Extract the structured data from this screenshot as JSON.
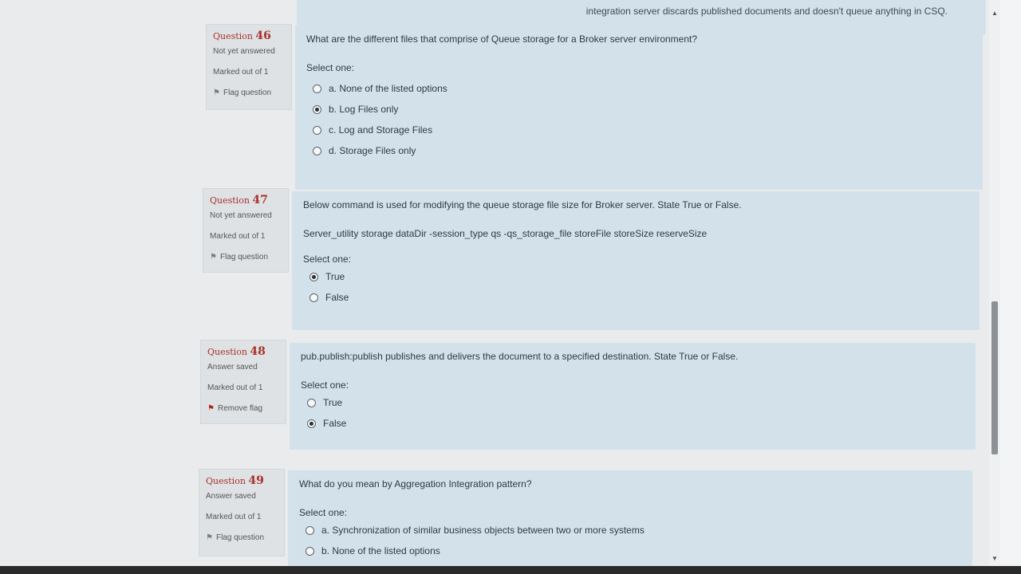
{
  "top_strip": {
    "text": "integration server discards published documents and doesn't queue anything in CSQ."
  },
  "questions": [
    {
      "label": "Question",
      "number": "46",
      "state": "Not yet answered",
      "mark": "Marked out of 1",
      "flag_label": "Flag question",
      "flagged": false,
      "text": "What are the different files that comprise of Queue storage for a Broker server environment?",
      "select_label": "Select one:",
      "options": [
        {
          "label": "a. None of the listed options",
          "checked": false
        },
        {
          "label": "b. Log Files only",
          "checked": true
        },
        {
          "label": "c. Log and Storage Files",
          "checked": false
        },
        {
          "label": "d. Storage Files only",
          "checked": false
        }
      ]
    },
    {
      "label": "Question",
      "number": "47",
      "state": "Not yet answered",
      "mark": "Marked out of 1",
      "flag_label": "Flag question",
      "flagged": false,
      "text": "Below command is used for modifying the queue storage file size for Broker server. State True or False.",
      "command": "Server_utility storage dataDir -session_type qs -qs_storage_file storeFile storeSize reserveSize",
      "select_label": "Select one:",
      "options": [
        {
          "label": "True",
          "checked": true
        },
        {
          "label": "False",
          "checked": false
        }
      ]
    },
    {
      "label": "Question",
      "number": "48",
      "state": "Answer saved",
      "mark": "Marked out of 1",
      "flag_label": "Remove flag",
      "flagged": true,
      "text": "pub.publish:publish publishes and delivers the document to a specified destination. State True or False.",
      "select_label": "Select one:",
      "options": [
        {
          "label": "True",
          "checked": false
        },
        {
          "label": "False",
          "checked": true
        }
      ]
    },
    {
      "label": "Question",
      "number": "49",
      "state": "Answer saved",
      "mark": "Marked out of 1",
      "flag_label": "Flag question",
      "flagged": false,
      "text": "What do you mean by Aggregation Integration pattern?",
      "select_label": "Select one:",
      "options": [
        {
          "label": "a. Synchronization of similar business objects between two or more systems",
          "checked": false
        },
        {
          "label": "b. None of the listed options",
          "checked": false
        }
      ]
    }
  ],
  "icons": {
    "flag": "flag-icon",
    "scroll_up": "chevron-up-icon",
    "scroll_down": "chevron-down-icon"
  }
}
